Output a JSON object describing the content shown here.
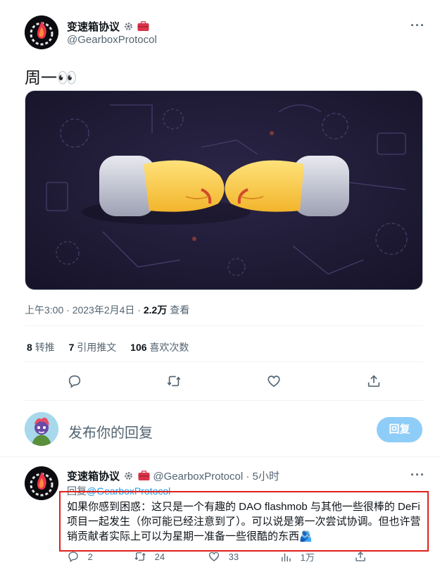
{
  "tweet": {
    "author_name": "变速箱协议",
    "author_handle": "@GearboxProtocol",
    "text": "周一👀",
    "meta": {
      "time": "上午3:00",
      "sep": " · ",
      "date": "2023年2月4日",
      "views_num": "2.2万",
      "views_label": " 查看"
    },
    "stats": {
      "retweets_num": "8",
      "retweets_label": "转推",
      "quotes_num": "7",
      "quotes_label": "引用推文",
      "likes_num": "106",
      "likes_label": "喜欢次数"
    },
    "image_alt": "two cartoon fists bumping"
  },
  "composer": {
    "placeholder": "发布你的回复",
    "button": "回复"
  },
  "reply": {
    "author_name": "变速箱协议",
    "author_handle": "@GearboxProtocol",
    "time": " · 5小时",
    "reply_to_prefix": "回复",
    "reply_to_handle": "@GearboxProtocol",
    "text": "如果你感到困惑：这只是一个有趣的 DAO flashmob 与其他一些很棒的 DeFi 项目一起发生（你可能已经注意到了）。可以说是第一次尝试协调。但也许营销贡献者实际上可以为星期一准备一些很酷的东西🫂",
    "counts": {
      "replies": "2",
      "retweets": "24",
      "likes": "33",
      "views": "1万"
    }
  },
  "colors": {
    "accent": "#1d9bf0",
    "highlight_box": "#e0201b",
    "reply_button": "#8ecdf8"
  },
  "icons": [
    "more-icon",
    "reply-icon",
    "retweet-icon",
    "like-icon",
    "share-icon",
    "views-icon",
    "gear-icon",
    "briefcase-icon"
  ]
}
